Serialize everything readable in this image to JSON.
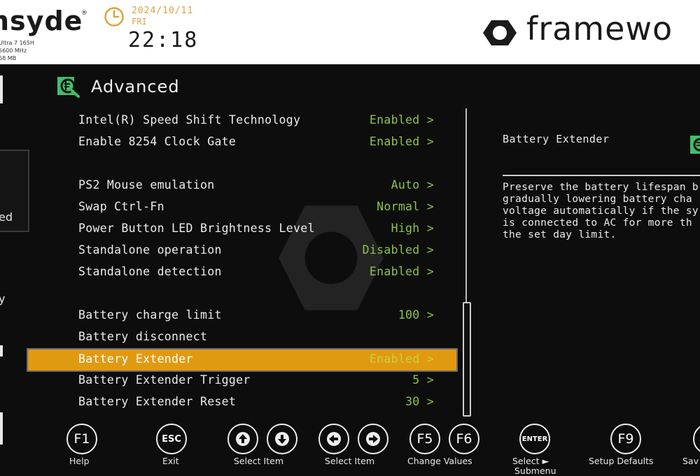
{
  "header": {
    "brand": "nsyde",
    "brand_mark": "®",
    "cpu": "Ultra 7 165H",
    "freq": "5600 MHz",
    "memory": "68 MB",
    "date": "2024/10/11",
    "day": "FRI",
    "time": "22:18",
    "oem": "framewo"
  },
  "nav": {
    "fragment_1": "ed",
    "fragment_2": "y"
  },
  "page": {
    "title": "Advanced"
  },
  "settings": [
    {
      "label": "Intel(R) Speed Shift Technology",
      "value": "Enabled >"
    },
    {
      "label": "Enable 8254 Clock Gate",
      "value": "Enabled >"
    },
    {
      "label": "PS2 Mouse emulation",
      "value": "Auto >"
    },
    {
      "label": "Swap Ctrl-Fn",
      "value": "Normal >"
    },
    {
      "label": "Power Button LED Brightness Level",
      "value": "High >"
    },
    {
      "label": "Standalone operation",
      "value": "Disabled >"
    },
    {
      "label": "Standalone detection",
      "value": "Enabled >"
    },
    {
      "label": "Battery charge limit",
      "value": "100 >"
    },
    {
      "label": "Battery disconnect",
      "value": ""
    },
    {
      "label": "Battery Extender",
      "value": "Enabled >"
    },
    {
      "label": "Battery Extender Trigger",
      "value": "5 >"
    },
    {
      "label": "Battery Extender Reset",
      "value": "30 >"
    }
  ],
  "help": {
    "title": "Battery Extender",
    "text": "Preserve the battery lifespan b\ngradually lowering battery cha\nvoltage automatically if the sy\nis connected to AC for more th\nthe set day limit."
  },
  "footer": {
    "keys": {
      "f1": "F1",
      "esc": "ESC",
      "f5": "F5",
      "f6": "F6",
      "enter": "ENTER",
      "f9": "F9"
    },
    "labels": {
      "help": "Help",
      "exit": "Exit",
      "select_item_ud": "Select Item",
      "select_item_lr": "Select Item",
      "change_values": "Change Values",
      "select_submenu_1": "Select ►",
      "select_submenu_2": "Submenu",
      "setup_defaults": "Setup Defaults",
      "save": "Sav"
    }
  },
  "colors": {
    "value_green": "#8bc34a",
    "selected_bg": "#e09a12",
    "date_gold": "#d9a441"
  }
}
